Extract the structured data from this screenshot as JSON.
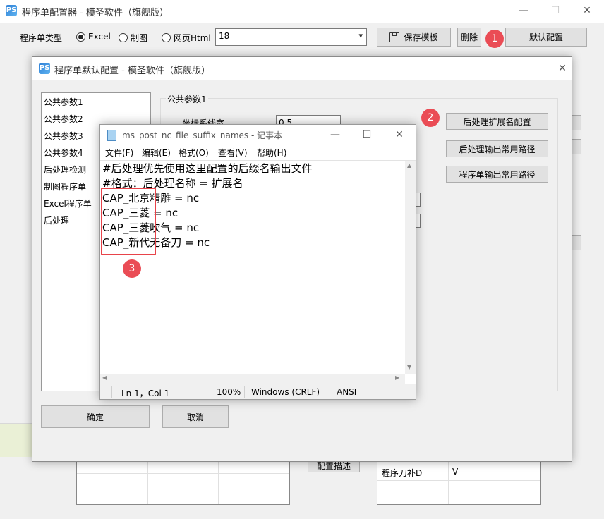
{
  "main_window": {
    "title": "程序单配置器 - 模圣软件（旗舰版）",
    "logo": "PS",
    "controls": {
      "minimize": "—",
      "maximize": "☐",
      "close": "✕"
    },
    "toolbar": {
      "type_label": "程序单类型",
      "radios": [
        {
          "label": "Excel",
          "selected": true
        },
        {
          "label": "制图",
          "selected": false
        },
        {
          "label": "网页Html",
          "selected": false
        }
      ],
      "combo_value": "18",
      "save_template": "保存模板",
      "delete": "删除",
      "default_config": "默认配置"
    },
    "bottom_button": "配置描述",
    "table_row": {
      "label": "程序刀补D",
      "value": "V"
    }
  },
  "dialog": {
    "title": "程序单默认配置 - 模圣软件（旗舰版）",
    "logo": "PS",
    "close": "✕",
    "list_items": [
      "公共参数1",
      "公共参数2",
      "公共参数3",
      "公共参数4",
      "后处理检测",
      "制图程序单",
      "Excel程序单",
      "后处理"
    ],
    "group_title": "公共参数1",
    "field_label": "坐标系线宽",
    "field_value": "0.5",
    "buttons": [
      "后处理扩展名配置",
      "后处理输出常用路径",
      "程序单输出常用路径"
    ],
    "ok": "确定",
    "cancel": "取消"
  },
  "notepad": {
    "title": "ms_post_nc_file_suffix_names - 记事本",
    "controls": {
      "minimize": "—",
      "maximize": "☐",
      "close": "✕"
    },
    "menu": [
      "文件(F)",
      "编辑(E)",
      "格式(O)",
      "查看(V)",
      "帮助(H)"
    ],
    "lines": [
      "#后处理优先使用这里配置的后缀名输出文件",
      "#格式：后处理名称 = 扩展名",
      "CAP_北京精雕 = nc",
      "CAP_三菱 = nc",
      "CAP_三菱吹气 = nc",
      "CAP_新代无备刀 = nc"
    ],
    "status": {
      "position": "Ln 1，Col 1",
      "zoom": "100%",
      "eol": "Windows (CRLF)",
      "encoding": "ANSI"
    }
  },
  "annotations": [
    "1",
    "2",
    "3"
  ],
  "colors": {
    "accent_red": "#ea4c55",
    "highlight_box": "#e8434a"
  }
}
